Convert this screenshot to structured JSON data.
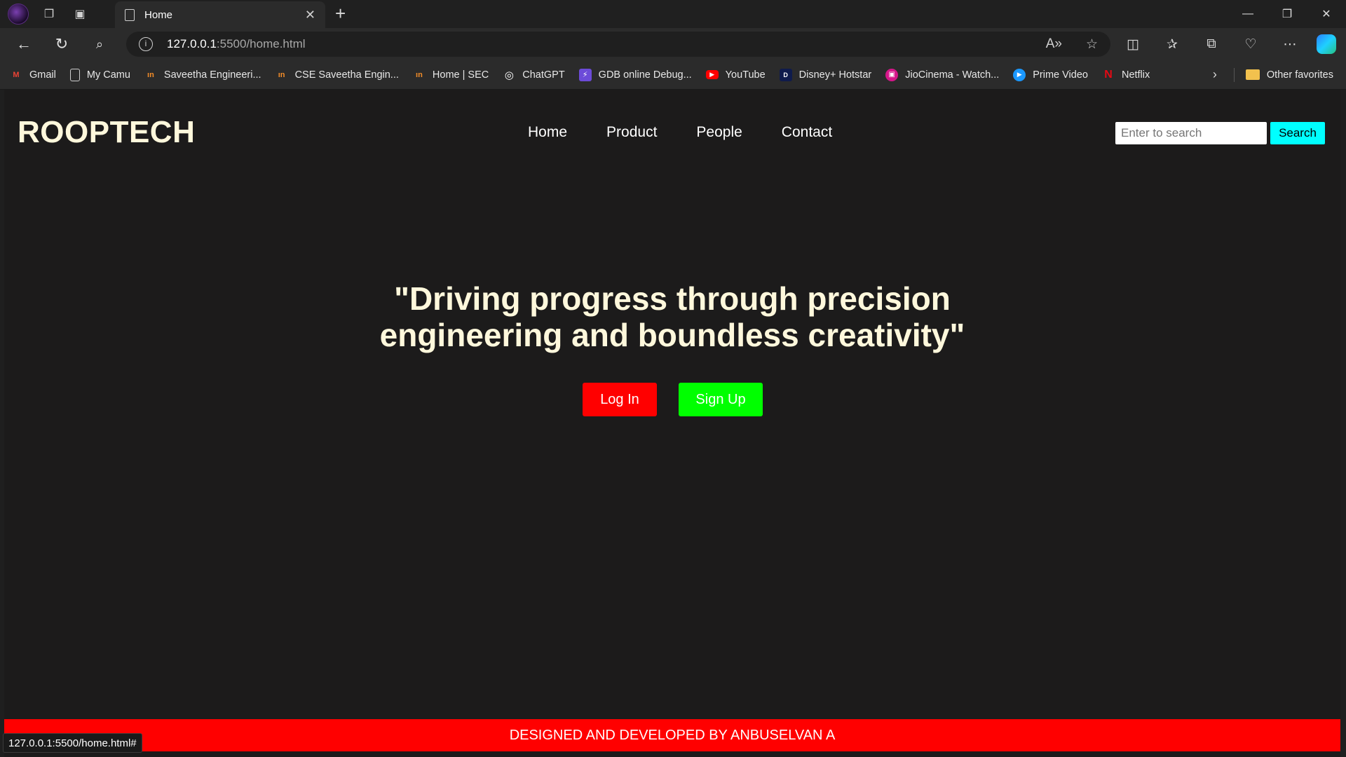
{
  "browser": {
    "tab": {
      "title": "Home"
    },
    "address": {
      "host": "127.0.0.1",
      "path": ":5500/home.html"
    },
    "bookmarks": [
      {
        "label": "Gmail",
        "icon": "gmail-icon",
        "color": "#ea4335",
        "glyph": "M"
      },
      {
        "label": "My Camu",
        "icon": "page-icon",
        "color": "#cfcfcf",
        "glyph": ""
      },
      {
        "label": "Saveetha Engineeri...",
        "icon": "saveetha-icon",
        "color": "#f28c28",
        "glyph": "ın"
      },
      {
        "label": "CSE Saveetha Engin...",
        "icon": "saveetha-icon",
        "color": "#f28c28",
        "glyph": "ın"
      },
      {
        "label": "Home | SEC",
        "icon": "saveetha-icon",
        "color": "#f28c28",
        "glyph": "ın"
      },
      {
        "label": "ChatGPT",
        "icon": "chatgpt-icon",
        "color": "#ffffff",
        "glyph": "◎"
      },
      {
        "label": "GDB online Debug...",
        "icon": "gdb-icon",
        "color": "#6c4bd8",
        "glyph": "⚡"
      },
      {
        "label": "YouTube",
        "icon": "youtube-icon",
        "color": "#ff0000",
        "glyph": "▶"
      },
      {
        "label": "Disney+ Hotstar",
        "icon": "hotstar-icon",
        "color": "#0f1b4c",
        "glyph": "D"
      },
      {
        "label": "JioCinema - Watch...",
        "icon": "jiocinema-icon",
        "color": "#d6168a",
        "glyph": "▣"
      },
      {
        "label": "Prime Video",
        "icon": "primevideo-icon",
        "color": "#1a98ff",
        "glyph": "▶"
      },
      {
        "label": "Netflix",
        "icon": "netflix-icon",
        "color": "#e50914",
        "glyph": "N"
      }
    ],
    "other_favorites": "Other favorites",
    "status_url": "127.0.0.1:5500/home.html#"
  },
  "site": {
    "brand": "ROOPTECH",
    "nav": [
      "Home",
      "Product",
      "People",
      "Contact"
    ],
    "search": {
      "placeholder": "Enter to search",
      "button": "Search"
    },
    "hero_line1": "\"Driving progress through precision",
    "hero_line2": "engineering and boundless creativity\"",
    "login_label": "Log In",
    "signup_label": "Sign Up",
    "footer": "DESIGNED AND DEVELOPED BY ANBUSELVAN A"
  },
  "colors": {
    "page_bg": "#1c1b1b",
    "brand_text": "#fff8dc",
    "login_button": "#ff0000",
    "signup_button": "#00ff00",
    "search_button": "#00ffff",
    "footer_bg": "#ff0000"
  }
}
